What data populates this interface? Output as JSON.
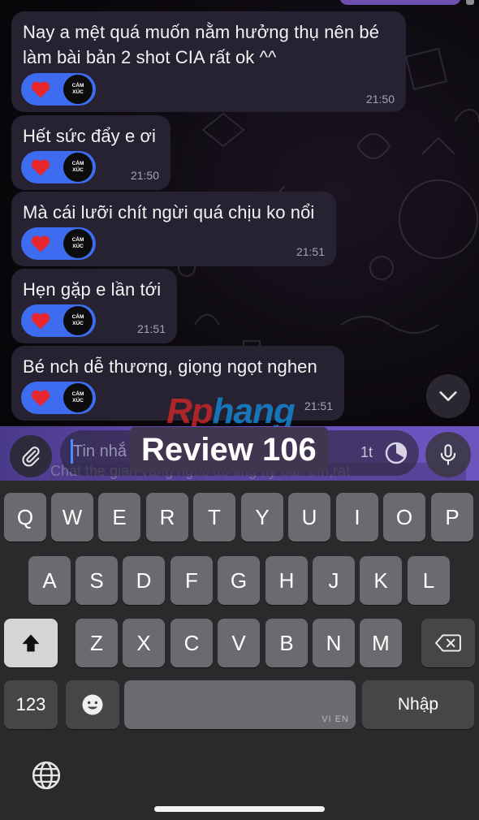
{
  "messages": [
    {
      "text": "Nay a mệt quá muốn nằm hưởng thụ nên bé\nlàm bài bản 2 shot CIA rất ok ^^",
      "time": "21:50",
      "reaction_label": "CẢM\nXÚC"
    },
    {
      "text": "Hết sức đẩy e ơi",
      "time": "21:50",
      "reaction_label": "CẢM\nXÚC"
    },
    {
      "text": "Mà cái lưỡi chít ngừi quá chịu ko nổi",
      "time": "21:51",
      "reaction_label": "CẢM\nXÚC"
    },
    {
      "text": "Hẹn gặp e lần tới",
      "time": "21:51",
      "reaction_label": "CẢM\nXÚC"
    },
    {
      "text": "Bé nch dễ thương, giọng ngọt nghen",
      "time": "21:51",
      "reaction_label": "CẢM\nXÚC"
    }
  ],
  "watermark": {
    "part1": "Rp",
    "part2": "hang"
  },
  "input": {
    "placeholder": "Tin nhắ",
    "overlay_label": "Review 106",
    "timer_label": "1t",
    "ghost_text": "Chat the gian vang ngoc do ting hy ban em,rat"
  },
  "keyboard": {
    "row1": [
      "Q",
      "W",
      "E",
      "R",
      "T",
      "Y",
      "U",
      "I",
      "O",
      "P"
    ],
    "row2": [
      "A",
      "S",
      "D",
      "F",
      "G",
      "H",
      "J",
      "K",
      "L"
    ],
    "row3": [
      "Z",
      "X",
      "C",
      "V",
      "B",
      "N",
      "M"
    ],
    "numbers_label": "123",
    "return_label": "Nhập",
    "space_lang_label": "VI EN"
  },
  "colors": {
    "bubble": "#272231",
    "reaction_pill": "#3d6cf0",
    "input_bar": "#6a4fc0",
    "keyboard_bg": "#2a2a2d"
  },
  "icons": [
    "heart-icon",
    "attach-icon",
    "mic-icon",
    "chevron-down-icon",
    "timer-icon",
    "shift-icon",
    "delete-icon",
    "emoji-icon",
    "globe-icon"
  ]
}
